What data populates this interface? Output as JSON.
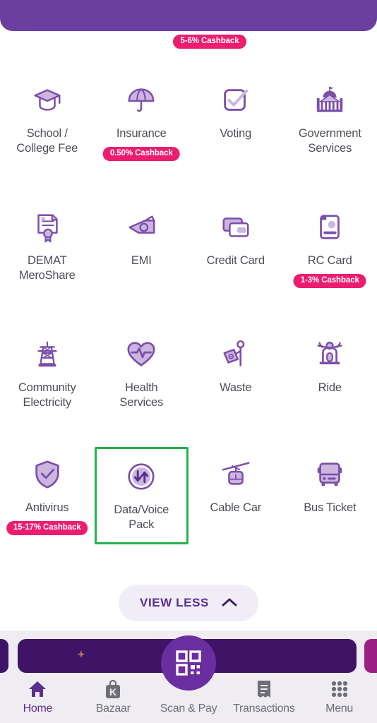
{
  "theme": {
    "brand_purple": "#6b3fa0",
    "deep_purple": "#5b2d90",
    "icon_purple": "#7b4ea8",
    "icon_fill_light": "#cbb6e0",
    "badge_pink": "#ec1c6e",
    "selection_green": "#24b24c",
    "label_gray": "#4e4e56",
    "nav_bg": "#efedf2"
  },
  "header": {
    "top_cashback_badge": "5-6% Cashback"
  },
  "grid": {
    "rows": [
      {
        "cells": [
          {
            "label": "School /\nCollege Fee",
            "icon": "graduation-cap-icon",
            "badge": null
          },
          {
            "label": "Insurance",
            "icon": "umbrella-icon",
            "badge": "0.50% Cashback"
          },
          {
            "label": "Voting",
            "icon": "checkbox-check-icon",
            "badge": null
          },
          {
            "label": "Government\nServices",
            "icon": "government-building-icon",
            "badge": null
          }
        ]
      },
      {
        "cells": [
          {
            "label": "DEMAT\nMeroShare",
            "icon": "certificate-icon",
            "badge": null
          },
          {
            "label": "EMI",
            "icon": "cash-money-icon",
            "badge": null
          },
          {
            "label": "Credit Card",
            "icon": "credit-cards-icon",
            "badge": null
          },
          {
            "label": "RC Card",
            "icon": "id-card-icon",
            "badge": "1-3% Cashback"
          }
        ]
      },
      {
        "cells": [
          {
            "label": "Community\nElectricity",
            "icon": "transmission-tower-icon",
            "badge": null
          },
          {
            "label": "Health\nServices",
            "icon": "heart-pulse-icon",
            "badge": null
          },
          {
            "label": "Waste",
            "icon": "waste-person-icon",
            "badge": null
          },
          {
            "label": "Ride",
            "icon": "scooter-icon",
            "badge": null
          }
        ]
      },
      {
        "cells": [
          {
            "label": "Antivirus",
            "icon": "shield-check-icon",
            "badge": "15-17% Cashback"
          },
          {
            "label": "Data/Voice\nPack",
            "icon": "data-transfer-icon",
            "badge": null,
            "selected": true
          },
          {
            "label": "Cable Car",
            "icon": "cable-car-icon",
            "badge": null
          },
          {
            "label": "Bus Ticket",
            "icon": "bus-icon",
            "badge": null
          }
        ]
      }
    ]
  },
  "view_toggle": {
    "label": "VIEW LESS",
    "icon": "chevron-up-icon"
  },
  "bottom_nav": {
    "items": [
      {
        "label": "Home",
        "icon": "home-icon",
        "active": true
      },
      {
        "label": "Bazaar",
        "icon": "shopping-bag-k-icon",
        "active": false
      },
      {
        "label": "Scan & Pay",
        "icon": "qr-code-icon",
        "active": false
      },
      {
        "label": "Transactions",
        "icon": "receipt-icon",
        "active": false
      },
      {
        "label": "Menu",
        "icon": "grid-dots-icon",
        "active": false
      }
    ],
    "fab_icon": "qr-code-icon"
  }
}
